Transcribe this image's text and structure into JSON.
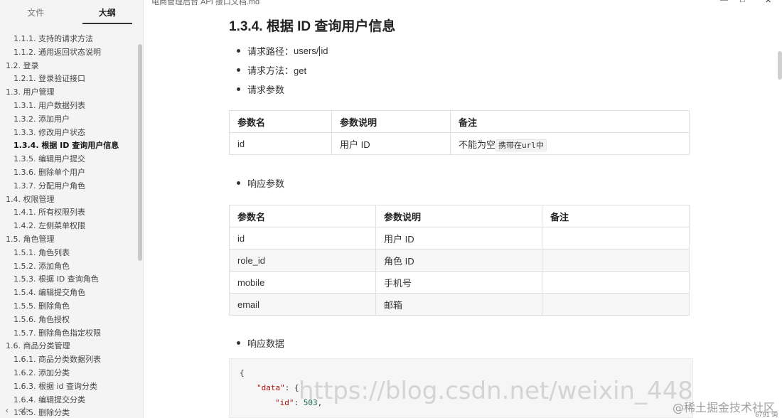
{
  "sidebar": {
    "tabs": [
      "文件",
      "大纲"
    ],
    "items": [
      {
        "label": "1.1.1. 支持的请求方法",
        "level": 3
      },
      {
        "label": "1.1.2. 通用返回状态说明",
        "level": 3
      },
      {
        "label": "1.2. 登录",
        "level": 2
      },
      {
        "label": "1.2.1. 登录验证接口",
        "level": 3
      },
      {
        "label": "1.3. 用户管理",
        "level": 2
      },
      {
        "label": "1.3.1. 用户数据列表",
        "level": 3
      },
      {
        "label": "1.3.2. 添加用户",
        "level": 3
      },
      {
        "label": "1.3.3. 修改用户状态",
        "level": 3
      },
      {
        "label": "1.3.4. 根据 ID 查询用户信息",
        "level": 3
      },
      {
        "label": "1.3.5. 编辑用户提交",
        "level": 3
      },
      {
        "label": "1.3.6. 删除单个用户",
        "level": 3
      },
      {
        "label": "1.3.7. 分配用户角色",
        "level": 3
      },
      {
        "label": "1.4. 权限管理",
        "level": 2
      },
      {
        "label": "1.4.1. 所有权限列表",
        "level": 3
      },
      {
        "label": "1.4.2. 左侧菜单权限",
        "level": 3
      },
      {
        "label": "1.5. 角色管理",
        "level": 2
      },
      {
        "label": "1.5.1. 角色列表",
        "level": 3
      },
      {
        "label": "1.5.2. 添加角色",
        "level": 3
      },
      {
        "label": "1.5.3. 根据 ID 查询角色",
        "level": 3
      },
      {
        "label": "1.5.4. 编辑提交角色",
        "level": 3
      },
      {
        "label": "1.5.5. 删除角色",
        "level": 3
      },
      {
        "label": "1.5.6. 角色授权",
        "level": 3
      },
      {
        "label": "1.5.7. 删除角色指定权限",
        "level": 3
      },
      {
        "label": "1.6. 商品分类管理",
        "level": 2
      },
      {
        "label": "1.6.1. 商品分类数据列表",
        "level": 3
      },
      {
        "label": "1.6.2. 添加分类",
        "level": 3
      },
      {
        "label": "1.6.3. 根据 id 查询分类",
        "level": 3
      },
      {
        "label": "1.6.4. 编辑提交分类",
        "level": 3
      },
      {
        "label": "1.6.5. 删除分类",
        "level": 3
      }
    ],
    "active_index": 8,
    "bottom_icons": [
      "chevron-left-icon",
      "code-icon"
    ]
  },
  "topbar": {
    "filename": "电商管理后台 API 接口文档.md"
  },
  "main": {
    "title": "1.3.4. 根据 ID 查询用户信息",
    "bullets": {
      "path_label": "请求路径：",
      "path_value_a": "users/",
      "path_value_b": "id",
      "method": "请求方法：get",
      "params": "请求参数",
      "response_params": "响应参数",
      "response_data": "响应数据"
    },
    "request_table": {
      "headers": [
        "参数名",
        "参数说明",
        "备注"
      ],
      "rows": [
        {
          "name": "id",
          "desc": "用户 ID",
          "note": "不能为空",
          "note_code": "携带在url中"
        }
      ]
    },
    "response_table": {
      "headers": [
        "参数名",
        "参数说明",
        "备注"
      ],
      "rows": [
        {
          "name": "id",
          "desc": "用户 ID",
          "note": ""
        },
        {
          "name": "role_id",
          "desc": "角色 ID",
          "note": ""
        },
        {
          "name": "mobile",
          "desc": "手机号",
          "note": ""
        },
        {
          "name": "email",
          "desc": "邮箱",
          "note": ""
        }
      ]
    },
    "code": {
      "line1": "{",
      "line2_key": "\"data\"",
      "line2_rest": ": {",
      "line3_key": "\"id\"",
      "line3_rest": ": ",
      "line3_num": "503",
      "line3_end": ","
    }
  },
  "watermark": "https://blog.csdn.net/weixin_448",
  "watermark2": "@稀土掘金技术社区",
  "word_count": "6791 词"
}
